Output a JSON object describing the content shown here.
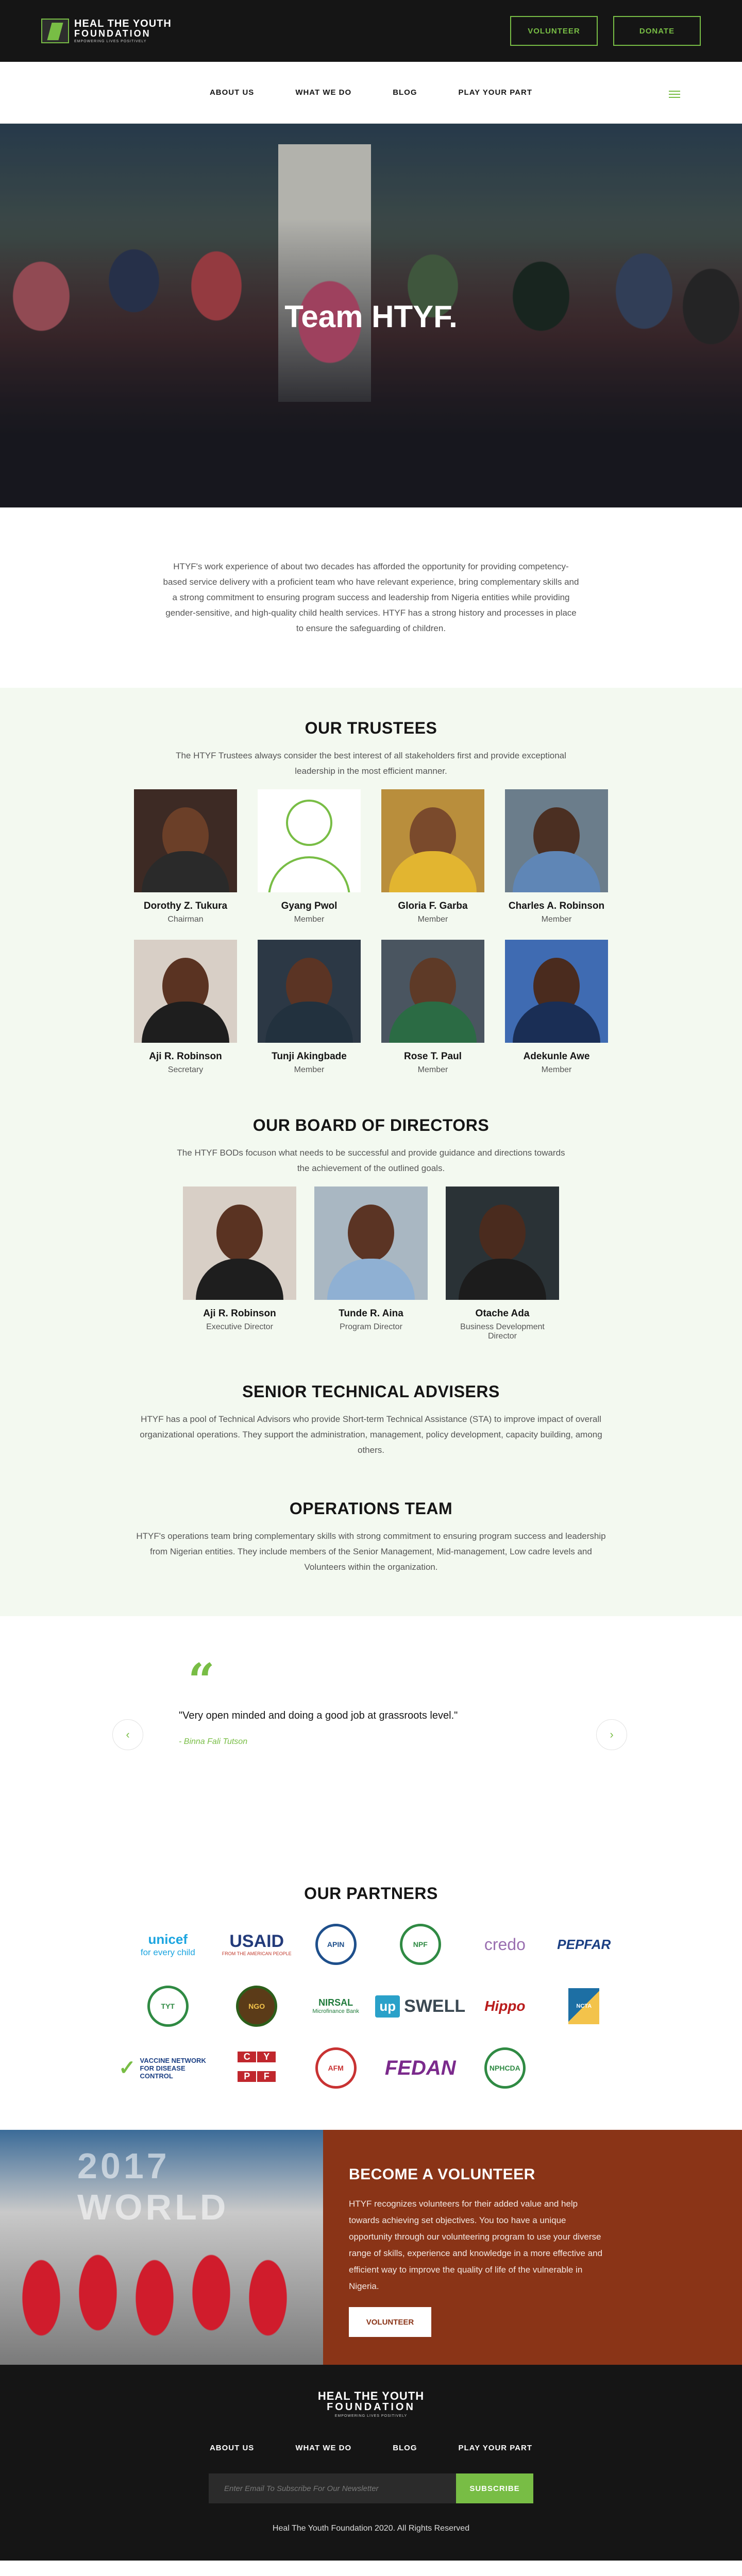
{
  "header": {
    "logo": {
      "line1": "HEAL THE YOUTH",
      "line2": "FOUNDATION",
      "tagline": "EMPOWERING LIVES POSITIVELY"
    },
    "volunteer_label": "VOLUNTEER",
    "donate_label": "DONATE"
  },
  "nav": {
    "items": [
      "ABOUT US",
      "WHAT WE DO",
      "BLOG",
      "PLAY YOUR PART"
    ],
    "menu_icon": "hamburger-icon"
  },
  "hero": {
    "title": "Team HTYF."
  },
  "intro": {
    "text": "HTYF's work experience of about two decades has afforded the opportunity for providing competency-based service delivery with a proficient team who have relevant experience, bring complementary skills and a strong commitment to ensuring program success and leadership from Nigeria entities while providing gender-sensitive, and high-quality child health services. HTYF has a strong history and processes in place to ensure the safeguarding of children."
  },
  "trustees": {
    "title": "OUR TRUSTEES",
    "description": "The HTYF Trustees always consider the best interest of all stakeholders first and provide exceptional leadership in the most efficient manner.",
    "members": [
      {
        "name": "Dorothy Z. Tukura",
        "role": "Chairman",
        "bg": "#3d2a24",
        "skin": "#6b3f28",
        "cloth": "#2a2a2a"
      },
      {
        "name": "Gyang Pwol",
        "role": "Member",
        "placeholder": true
      },
      {
        "name": "Gloria F. Garba",
        "role": "Member",
        "bg": "#b98e3c",
        "skin": "#7a4a2c",
        "cloth": "#e2b530"
      },
      {
        "name": "Charles A. Robinson",
        "role": "Member",
        "bg": "#6b7d8b",
        "skin": "#4b2f22",
        "cloth": "#5f86b6"
      },
      {
        "name": "Aji R. Robinson",
        "role": "Secretary",
        "bg": "#d8cfc6",
        "skin": "#5a3322",
        "cloth": "#1e1e1e"
      },
      {
        "name": "Tunji Akingbade",
        "role": "Member",
        "bg": "#2c3845",
        "skin": "#5b3424",
        "cloth": "#22313e"
      },
      {
        "name": "Rose T. Paul",
        "role": "Member",
        "bg": "#4a5560",
        "skin": "#5e3a27",
        "cloth": "#2b6b44"
      },
      {
        "name": "Adekunle Awe",
        "role": "Member",
        "bg": "#3f6bb2",
        "skin": "#4a2b1e",
        "cloth": "#1a2e55"
      }
    ]
  },
  "board": {
    "title": "OUR BOARD OF DIRECTORS",
    "description": "The HTYF BODs focuson what needs to be successful and provide guidance and directions towards the achievement of the outlined goals.",
    "members": [
      {
        "name": "Aji R. Robinson",
        "role": "Executive Director",
        "bg": "#d8cfc6",
        "skin": "#5a3322",
        "cloth": "#1e1e1e"
      },
      {
        "name": "Tunde R. Aina",
        "role": "Program Director",
        "bg": "#a9b7c2",
        "skin": "#5b3424",
        "cloth": "#8fb0d3"
      },
      {
        "name": "Otache Ada",
        "role": "Business Development Director",
        "bg": "#2a3236",
        "skin": "#4a2b1e",
        "cloth": "#1c1c1c"
      }
    ]
  },
  "advisers": {
    "title": "SENIOR TECHNICAL ADVISERS",
    "description": "HTYF has a pool of Technical Advisors who provide Short-term Technical Assistance (STA) to improve impact of overall organizational operations. They support the administration, management, policy development, capacity building, among others."
  },
  "operations": {
    "title": "OPERATIONS TEAM",
    "description": "HTYF's operations team bring complementary skills with strong commitment to ensuring program success and leadership from Nigerian entities. They include members of the Senior Management, Mid-management, Low cadre levels and Volunteers within the organization."
  },
  "testimonial": {
    "quote_icon": "quote-icon",
    "text": "\"Very open minded and doing a good job at grassroots level.\"",
    "author": "- Binna Fali Tutson",
    "prev_icon": "chevron-left-icon",
    "next_icon": "chevron-right-icon"
  },
  "partners": {
    "title": "OUR PARTNERS",
    "logos": {
      "unicef": "unicef",
      "unicef_sub": "for every child",
      "usaid": "USAID",
      "usaid_sub": "FROM THE AMERICAN PEOPLE",
      "apin": "APIN",
      "nigeria_police": "NPF",
      "credo": "credo",
      "pepfar": "PEPFAR",
      "tyt": "TYT",
      "ngo": "NGO",
      "nirsal": "NIRSAL",
      "nirsal_sub": "Microfinance Bank",
      "swell_up": "up",
      "swell": "SWELL",
      "hippo": "Hippo",
      "ncta": "NCTA",
      "vaccine": "VACCINE NETWORK FOR DISEASE CONTROL",
      "cypf": [
        "C",
        "Y",
        "P",
        "F"
      ],
      "afm": "AFM",
      "fedan": "FEDAN",
      "nphcda": "NPHCDA"
    }
  },
  "volunteer": {
    "photo_sign": "2017 WORLD",
    "title": "BECOME A VOLUNTEER",
    "text": "HTYF recognizes volunteers for their added value and help towards achieving set objectives. You too have a unique opportunity through our volunteering program to use your diverse range of skills, experience and knowledge in a more effective and efficient way to improve the quality of life of the vulnerable in Nigeria.",
    "button_label": "VOLUNTEER"
  },
  "footer": {
    "logo": {
      "line1": "HEAL THE YOUTH",
      "line2": "FOUNDATION",
      "tagline": "EMPOWERING LIVES POSITIVELY"
    },
    "nav": [
      "ABOUT US",
      "WHAT WE DO",
      "BLOG",
      "PLAY YOUR PART"
    ],
    "newsletter_placeholder": "Enter Email To Subscribe For Our Newsletter",
    "subscribe_label": "SUBSCRIBE",
    "copyright": "Heal The Youth Foundation 2020. All Rights Reserved"
  },
  "colors": {
    "accent": "#78bd45",
    "dark": "#151515",
    "volunteer_bg": "#8a3417",
    "section_bg": "#f3f9f0"
  }
}
